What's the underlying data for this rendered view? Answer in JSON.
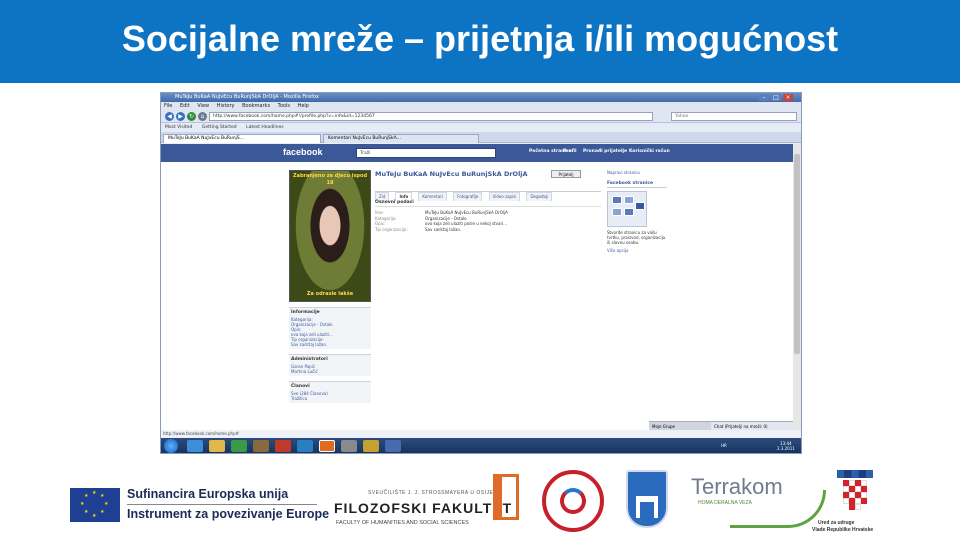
{
  "slide": {
    "title": "Socijalne mreže – prijetnja i/ili mogućnost"
  },
  "colors": {
    "title_bar": "#0d74c4",
    "facebook_blue": "#3b5998"
  },
  "browser": {
    "window_title": "MuTeJu BuKaA NuJvEcu BuRunjSkA DrOljA - Mozilla Firefox",
    "menu": [
      "File",
      "Edit",
      "View",
      "History",
      "Bookmarks",
      "Tools",
      "Help"
    ],
    "url": "http://www.facebook.com/home.php#!/profile.php?v=info&id=1234567",
    "search_placeholder": "Yahoo",
    "bookmarks": [
      "Most Visited",
      "Getting Started",
      "Latest Headlines"
    ],
    "tabs": [
      "MuTeJu BuKaA NuJvEcu BuRunjS...",
      "Komentari NuJvEcu BuRunjSkA..."
    ],
    "status_url": "http://www.facebook.com/home.php#"
  },
  "facebook": {
    "logo": "facebook",
    "search_value": "Traži",
    "nav": [
      "Početna stranica",
      "Profil",
      "Pronađi prijatelje",
      "Korisnički račun"
    ],
    "profile_name": "MuTeJu BuKaA NuJvEcu BuRunjSkA DrOljA",
    "add_friend": "Prijatelj",
    "picture_top_caption": "Zabranjeno za djecu ispod 18",
    "picture_bottom_caption": "Za odrasle lakše",
    "tabs": [
      "Zid",
      "Info",
      "Komentari",
      "Fotografije",
      "Video zapisi",
      "Događaji"
    ],
    "active_tab": "Info",
    "basic_info_title": "Osnovni podaci",
    "basic_info": [
      {
        "key": "Ime:",
        "value": "MuTeJu BuKaA NuJvEcu BuRunjSkA DrOljA"
      },
      {
        "key": "Kategorija:",
        "value": "Organizacije - Ostalo"
      },
      {
        "key": "Opis:",
        "value": "ovo koja zeli ulaziti posle u nekoj stvari..."
      },
      {
        "key": "Tip organizacije:",
        "value": "Sav sadržaj lažan."
      }
    ],
    "sidebar_info": {
      "title": "Informacije",
      "lines": [
        "Kategorija:",
        "Organizacije - Ostalo",
        "Opis:",
        "ova koja zeli ulaziti...",
        "Tip organizacije:",
        "Sav sadržaj lažan."
      ]
    },
    "admins": {
      "title": "Administratori",
      "lines": [
        "Goran Papić",
        "Martina Lučić"
      ]
    },
    "members": {
      "title": "Članovi",
      "lines": [
        "Sve (284 Članova)",
        "Tražilica"
      ]
    },
    "right_top": "Napravi stranicu",
    "pages_title": "Facebook stranice",
    "pages_desc": "Stvorite stranicu za vašu tvrtku, proizvod, organizaciju ili slavnu osobu.",
    "more_link": "Više opcija",
    "chat_label": "Moje Grupe",
    "chat_online": "Chat (Prijatelji na mreži: 0)"
  },
  "taskbar": {
    "tray_lang": "HR",
    "time": "13:44",
    "date": "2.3.2011"
  },
  "logos": {
    "eu_line1": "Sufinancira Europska unija",
    "eu_line2": "Instrument za povezivanje Europe",
    "ff_small": "SVEUČILIŠTE J. J. STROSSMAYERA U OSIJEKU",
    "ff_big": "FILOZOFSKI FAKULTET",
    "ff_sub": "FACULTY OF HUMANITIES AND SOCIAL SCIENCES",
    "terrakom_name": "Terrakom",
    "terrakom_tag": "HOMA DERALNA VEZA",
    "croatia_line1": "Ured za udruge",
    "croatia_line2": "Vlade Republike Hrvatske"
  }
}
